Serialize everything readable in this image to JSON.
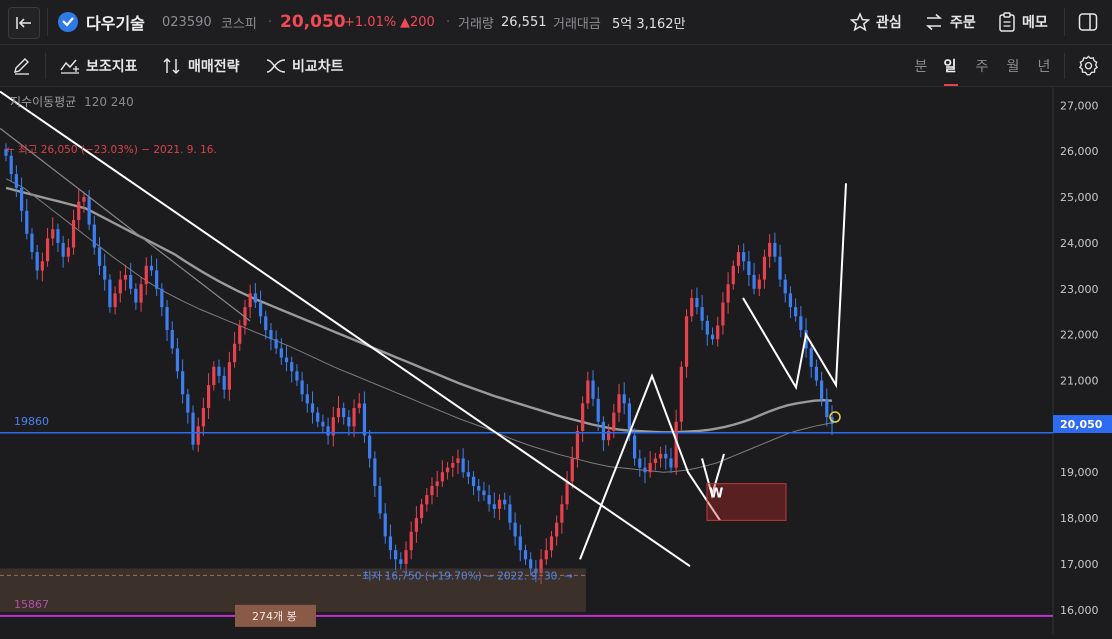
{
  "header": {
    "stock_name": "다우기술",
    "stock_code": "023590",
    "market": "코스피",
    "price": "20,050",
    "change_pct": "+1.01%",
    "change_abs": "▲200",
    "volume_label": "거래량",
    "volume_value": "26,551",
    "amount_label": "거래대금",
    "amount_value": "5억 3,162만",
    "watch_label": "관심",
    "order_label": "주문",
    "memo_label": "메모"
  },
  "toolbar": {
    "indicator_label": "보조지표",
    "strategy_label": "매매전략",
    "compare_label": "비교차트",
    "periods": [
      "분",
      "일",
      "주",
      "월",
      "년"
    ],
    "active_period": "일"
  },
  "colors": {
    "up": "#e8424f",
    "down": "#3d7ff0",
    "ma120": "#7d7d7d",
    "ma240": "#9a9a9a",
    "hline_blue": "#2e6bf0",
    "hline_magenta": "#c32fd1",
    "drawing": "#ffffff"
  },
  "chart_data": {
    "type": "candlestick",
    "ma_legend": "지수이동평균",
    "ma_periods": "120 240",
    "y_ticks": [
      "27,000",
      "26,000",
      "25,000",
      "24,000",
      "23,000",
      "22,000",
      "21,000",
      "20,000",
      "19,000",
      "18,000",
      "17,000",
      "16,000"
    ],
    "y_tick_values": [
      27000,
      26000,
      25000,
      24000,
      23000,
      22000,
      21000,
      20000,
      19000,
      18000,
      17000,
      16000
    ],
    "ylim": [
      15450,
      27400
    ],
    "current_price_label": "20,050",
    "current_price": 20050,
    "hline_blue_value": 19860,
    "hline_blue_label": "19860",
    "hline_magenta_value": 15867,
    "hline_magenta_label": "15867",
    "high_annotation": "← 최고 26,050 (−23.03%) − 2021. 9. 16.",
    "low_annotation": "최저 16,750 (+19.70%) − 2022. 9. 30. →",
    "range_label": "274개 봉",
    "w_label": "W",
    "approx_closes": [
      25900,
      25500,
      25200,
      24700,
      24200,
      23800,
      23400,
      23600,
      24100,
      24300,
      24000,
      23700,
      23900,
      24500,
      24900,
      25000,
      24400,
      23900,
      23500,
      23200,
      22600,
      22900,
      23200,
      23300,
      23000,
      22700,
      23100,
      23500,
      23400,
      23000,
      22600,
      22100,
      21700,
      21200,
      20700,
      20300,
      19600,
      20000,
      20400,
      20900,
      21300,
      21100,
      20800,
      21400,
      21800,
      22200,
      22600,
      22900,
      22700,
      22400,
      22100,
      21900,
      21700,
      21500,
      21400,
      21200,
      21000,
      20700,
      20500,
      20300,
      20100,
      20000,
      19800,
      20200,
      20400,
      20200,
      20000,
      20400,
      20500,
      19800,
      19300,
      18700,
      18100,
      17600,
      17300,
      17100,
      17000,
      17300,
      17700,
      18000,
      18300,
      18500,
      18700,
      18800,
      19000,
      19100,
      19200,
      19300,
      19000,
      18900,
      18700,
      18600,
      18500,
      18300,
      18200,
      18400,
      18300,
      17900,
      17600,
      17300,
      17100,
      16900,
      16800,
      17100,
      17300,
      17600,
      17900,
      18300,
      18800,
      19300,
      19900,
      20500,
      21000,
      20600,
      20100,
      19700,
      19900,
      20300,
      20700,
      20500,
      19800,
      19300,
      19100,
      19000,
      19200,
      19300,
      19400,
      19300,
      19100,
      20100,
      21300,
      22400,
      22800,
      22600,
      22300,
      22000,
      21900,
      22200,
      22700,
      23100,
      23500,
      23800,
      23600,
      23300,
      23000,
      23200,
      23700,
      24000,
      23700,
      23200,
      22900,
      22600,
      22400,
      22100,
      21700,
      21300,
      21000,
      20600,
      20200,
      20050
    ],
    "ma120": [
      25400,
      25300,
      25200,
      25050,
      24900,
      24750,
      24600,
      24450,
      24300,
      24150,
      24000,
      23850,
      23700,
      23560,
      23420,
      23280,
      23150,
      23030,
      22920,
      22820,
      22720,
      22630,
      22540,
      22460,
      22380,
      22300,
      22220,
      22140,
      22060,
      21980,
      21900,
      21820,
      21740,
      21650,
      21560,
      21470,
      21380,
      21290,
      21210,
      21130,
      21050,
      20970,
      20890,
      20810,
      20730,
      20650,
      20570,
      20490,
      20410,
      20330,
      20250,
      20170,
      20100,
      20030,
      19960,
      19880,
      19800,
      19720,
      19650,
      19580,
      19520,
      19460,
      19400,
      19350,
      19300,
      19250,
      19200,
      19160,
      19120,
      19100,
      19080,
      19060,
      19040,
      19020,
      19000,
      19010,
      19030,
      19060,
      19100,
      19150,
      19200,
      19280,
      19360,
      19440,
      19520,
      19600,
      19680,
      19760,
      19840,
      19900,
      19950,
      20000,
      20040,
      20080
    ],
    "ma240": [
      25200,
      25150,
      25100,
      25050,
      25000,
      24950,
      24900,
      24850,
      24800,
      24750,
      24650,
      24550,
      24450,
      24350,
      24250,
      24150,
      24050,
      23950,
      23850,
      23750,
      23620,
      23500,
      23380,
      23270,
      23160,
      23060,
      22960,
      22870,
      22780,
      22700,
      22620,
      22540,
      22460,
      22380,
      22300,
      22220,
      22140,
      22060,
      21980,
      21900,
      21820,
      21740,
      21660,
      21580,
      21500,
      21420,
      21340,
      21260,
      21180,
      21100,
      21020,
      20940,
      20870,
      20800,
      20730,
      20660,
      20600,
      20540,
      20480,
      20420,
      20360,
      20300,
      20240,
      20190,
      20140,
      20090,
      20040,
      20000,
      19960,
      19930,
      19910,
      19900,
      19890,
      19880,
      19870,
      19870,
      19880,
      19890,
      19900,
      19920,
      19950,
      19990,
      20040,
      20100,
      20170,
      20250,
      20330,
      20400,
      20460,
      20500,
      20530,
      20560,
      20570,
      20560
    ]
  }
}
